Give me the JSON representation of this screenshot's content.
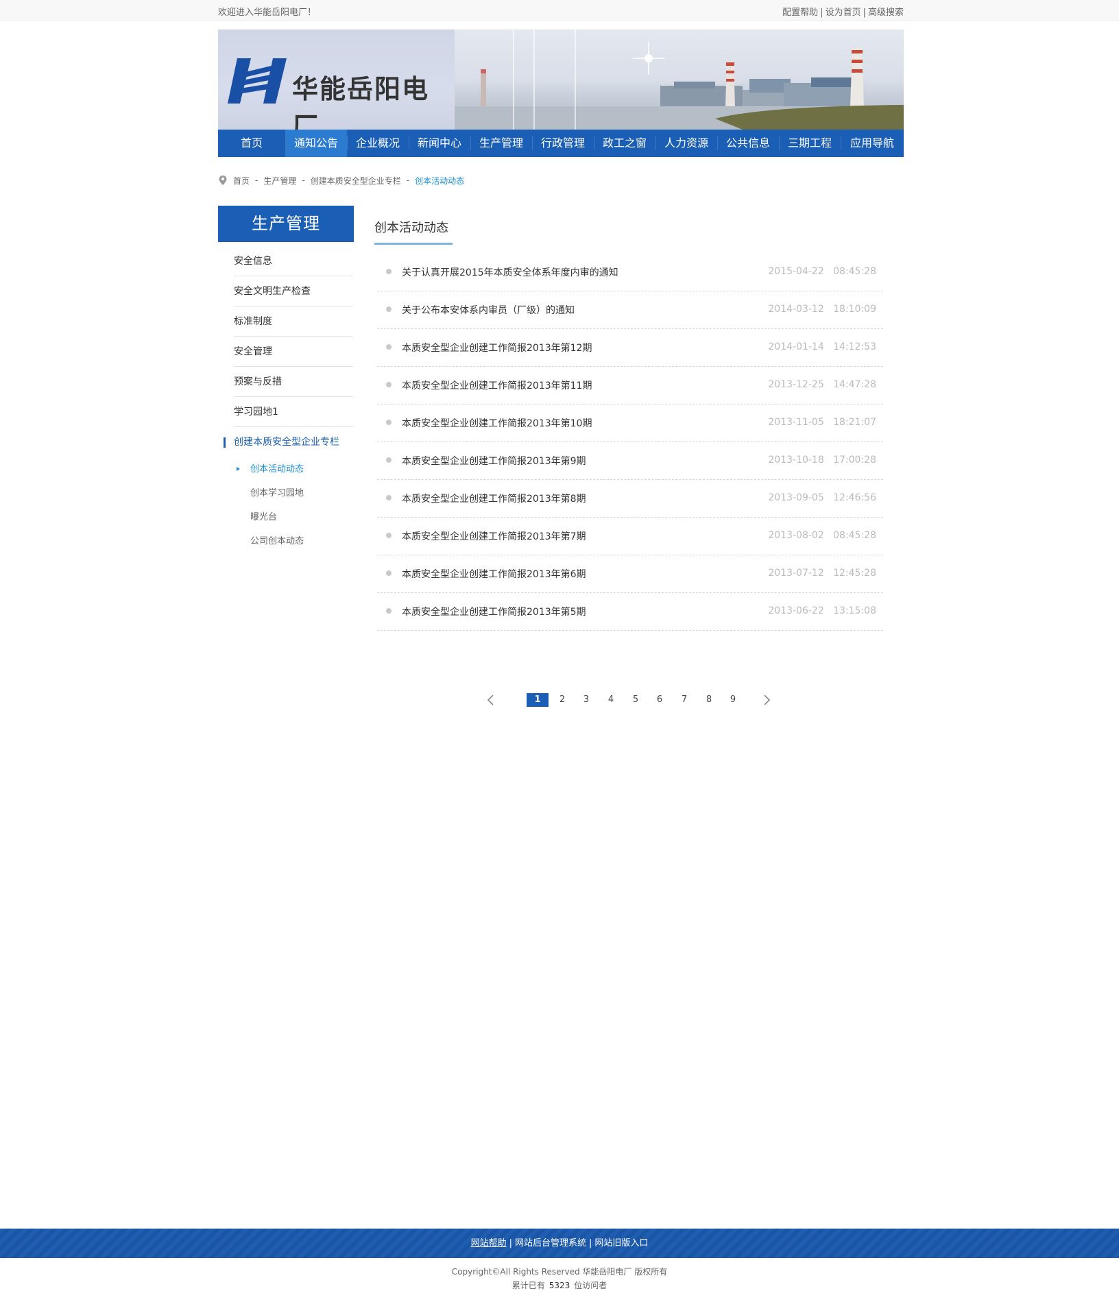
{
  "topbar": {
    "welcome": "欢迎进入华能岳阳电厂！",
    "links": [
      "配置帮助",
      "设为首页",
      "高级搜索"
    ],
    "separator": "|"
  },
  "banner": {
    "logo_text": "华能岳阳电厂",
    "logo_icon": "huaneng-h-logo"
  },
  "nav": {
    "items": [
      "首页",
      "通知公告",
      "企业概况",
      "新闻中心",
      "生产管理",
      "行政管理",
      "政工之窗",
      "人力资源",
      "公共信息",
      "三期工程",
      "应用导航"
    ],
    "active_index": 1
  },
  "breadcrumb": {
    "icon": "location-pin-icon",
    "items": [
      "首页",
      "生产管理",
      "创建本质安全型企业专栏",
      "创本活动动态"
    ],
    "separator": "-"
  },
  "sidebar": {
    "title": "生产管理",
    "items": [
      "安全信息",
      "安全文明生产检查",
      "标准制度",
      "安全管理",
      "预案与反措",
      "学习园地1",
      "创建本质安全型企业专栏"
    ],
    "active_index": 6,
    "sub_items": [
      "创本活动动态",
      "创本学习园地",
      "曝光台",
      "公司创本动态"
    ],
    "active_sub_index": 0
  },
  "main": {
    "section_title": "创本活动动态",
    "news": [
      {
        "title": "关于认真开展2015年本质安全体系年度内审的通知",
        "date": "2015-04-22",
        "time": "08:45:28"
      },
      {
        "title": "关于公布本安体系内审员（厂级）的通知",
        "date": "2014-03-12",
        "time": "18:10:09"
      },
      {
        "title": "本质安全型企业创建工作简报2013年第12期",
        "date": "2014-01-14",
        "time": "14:12:53"
      },
      {
        "title": "本质安全型企业创建工作简报2013年第11期",
        "date": "2013-12-25",
        "time": "14:47:28"
      },
      {
        "title": "本质安全型企业创建工作简报2013年第10期",
        "date": "2013-11-05",
        "time": "18:21:07"
      },
      {
        "title": "本质安全型企业创建工作简报2013年第9期",
        "date": "2013-10-18",
        "time": "17:00:28"
      },
      {
        "title": "本质安全型企业创建工作简报2013年第8期",
        "date": "2013-09-05",
        "time": "12:46:56"
      },
      {
        "title": "本质安全型企业创建工作简报2013年第7期",
        "date": "2013-08-02",
        "time": "08:45:28"
      },
      {
        "title": "本质安全型企业创建工作简报2013年第6期",
        "date": "2013-07-12",
        "time": "12:45:28"
      },
      {
        "title": "本质安全型企业创建工作简报2013年第5期",
        "date": "2013-06-22",
        "time": "13:15:08"
      }
    ]
  },
  "pagination": {
    "pages": [
      "1",
      "2",
      "3",
      "4",
      "5",
      "6",
      "7",
      "8",
      "9"
    ],
    "current": "1",
    "prev_icon": "chevron-left-icon",
    "next_icon": "chevron-right-icon"
  },
  "footer": {
    "links": [
      "网站帮助",
      "网站后台管理系统",
      "网站旧版入口"
    ],
    "copyright": "Copyright©All Rights Reserved   华能岳阳电厂   版权所有",
    "visitors_prefix": "累计已有",
    "visitors_count": "5323",
    "visitors_suffix": "位访问者"
  },
  "colors": {
    "primary": "#1a5fb5",
    "accent": "#1a8fd6",
    "muted_date": "#bbbbbb"
  }
}
